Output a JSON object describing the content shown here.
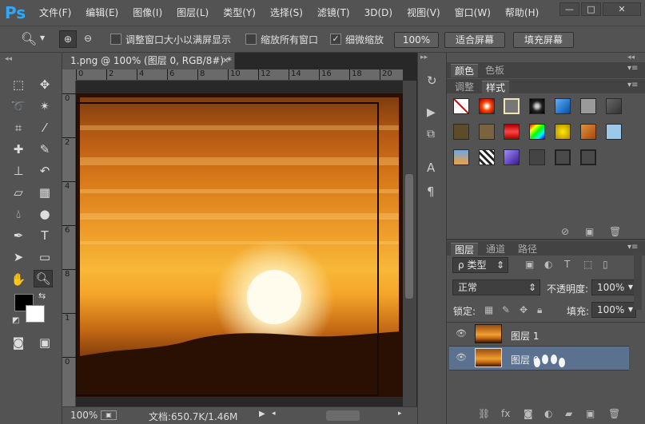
{
  "app": {
    "logo": "Ps"
  },
  "menu": [
    "文件(F)",
    "编辑(E)",
    "图像(I)",
    "图层(L)",
    "类型(Y)",
    "选择(S)",
    "滤镜(T)",
    "3D(D)",
    "视图(V)",
    "窗口(W)",
    "帮助(H)"
  ],
  "window_controls": {
    "minimize": "—",
    "maximize": "□",
    "close": "✕"
  },
  "options": {
    "resize_windows_label": "调整窗口大小以满屏显示",
    "resize_windows_checked": false,
    "zoom_all_label": "缩放所有窗口",
    "zoom_all_checked": false,
    "scrubby_zoom_label": "细微缩放",
    "scrubby_zoom_checked": true,
    "btn_100": "100%",
    "btn_fit": "适合屏幕",
    "btn_fill": "填充屏幕"
  },
  "document": {
    "tab_title": "1.png @ 100% (图层 0, RGB/8#) *",
    "close": "✕",
    "ruler_h": [
      "0",
      "2",
      "4",
      "6",
      "8",
      "10",
      "12",
      "14",
      "16",
      "18",
      "20"
    ],
    "ruler_v": [
      "0",
      "2",
      "4",
      "6",
      "8",
      "1",
      "0"
    ],
    "zoom": "100%",
    "doc_info": "文档:650.7K/1.46M"
  },
  "colors": {
    "foreground": "#000000",
    "background": "#ffffff",
    "canvas_frame": "#2b0f03"
  },
  "panels": {
    "top_tabs_row1": [
      "颜色",
      "色板"
    ],
    "top_tabs_row2": [
      "调整",
      "样式"
    ],
    "styles_swatches": [
      "none",
      "red-glow",
      "white-frame",
      "dark-ring",
      "blue-box",
      "gray",
      "dark-gray",
      "brown",
      "tan",
      "red-stripe",
      "rainbow",
      "yellow",
      "orange",
      "light-blue",
      "sky",
      "checker",
      "purple",
      "dark",
      "dark-outline",
      "dark-outline"
    ],
    "layers_tabs": [
      "图层",
      "通道",
      "路径"
    ],
    "filter_kind": "类型",
    "blend_mode": "正常",
    "opacity_label": "不透明度:",
    "opacity_value": "100%",
    "lock_label": "锁定:",
    "fill_label": "填充:",
    "fill_value": "100%",
    "layers": [
      {
        "name": "图层 1",
        "selected": false
      },
      {
        "name": "图层 0",
        "selected": true
      }
    ]
  }
}
